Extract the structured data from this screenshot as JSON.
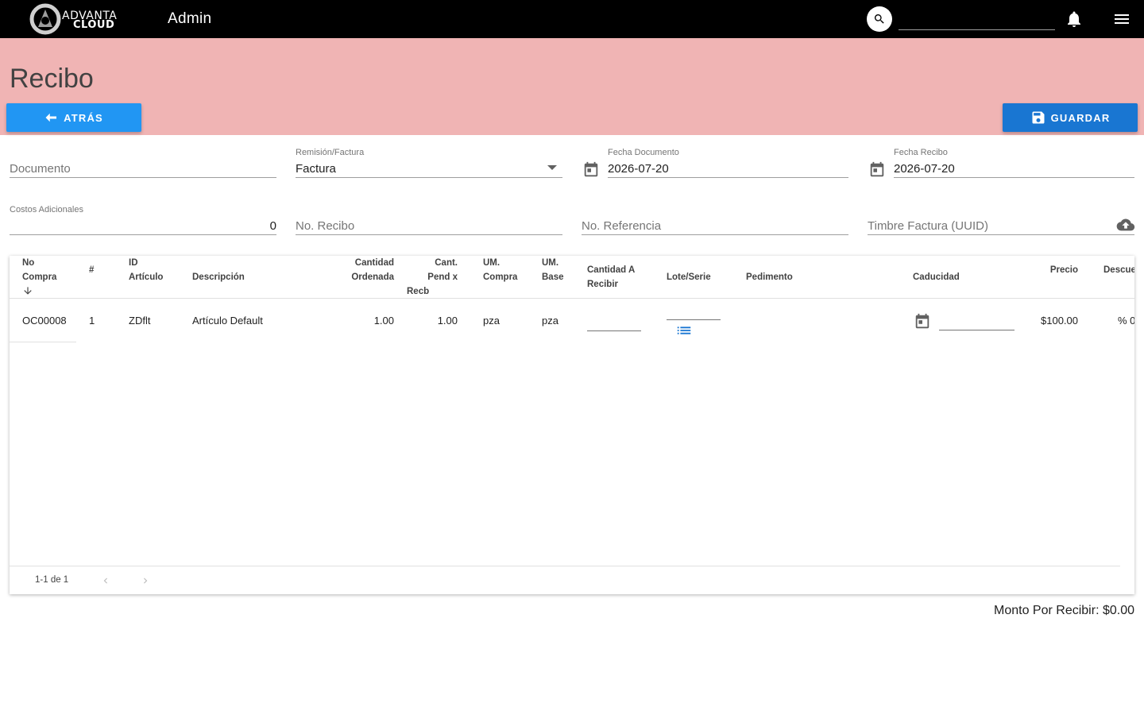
{
  "topbar": {
    "logo_line1": "ADVANTA",
    "logo_line2": "CLOUD",
    "title": "Admin",
    "search_value": "",
    "icons": [
      "search-icon",
      "bell-icon",
      "menu-icon"
    ]
  },
  "header": {
    "title": "Recibo",
    "back_label": "ATRÁS",
    "save_label": "GUARDAR",
    "band_color": "#f0b4b4",
    "back_color": "#2196f3",
    "save_color": "#1976d2"
  },
  "form": {
    "documento": {
      "placeholder": "Documento",
      "value": ""
    },
    "remision_factura": {
      "label": "Remisión/Factura",
      "value": "Factura"
    },
    "fecha_documento": {
      "label": "Fecha Documento",
      "value": "2026-07-20"
    },
    "fecha_recibo": {
      "label": "Fecha Recibo",
      "value": "2026-07-20"
    },
    "costos_adicionales": {
      "label": "Costos Adicionales",
      "value": "0"
    },
    "no_recibo": {
      "placeholder": "No. Recibo",
      "value": ""
    },
    "no_referencia": {
      "placeholder": "No. Referencia",
      "value": ""
    },
    "timbre": {
      "placeholder": "Timbre Factura (UUID)",
      "value": ""
    }
  },
  "table": {
    "headers": {
      "no_compra_1": "No",
      "no_compra_2": "Compra",
      "num": "#",
      "id_articulo_1": "ID",
      "id_articulo_2": "Artículo",
      "descripcion": "Descripción",
      "cant_ordenada_1": "Cantidad",
      "cant_ordenada_2": "Ordenada",
      "cant_pend_1": "Cant.",
      "cant_pend_2": "Pend x",
      "cant_pend_3": "Recb",
      "um_compra_1": "UM.",
      "um_compra_2": "Compra",
      "um_base_1": "UM.",
      "um_base_2": "Base",
      "cant_recibir_1": "Cantidad A",
      "cant_recibir_2": "Recibir",
      "lote_serie": "Lote/Serie",
      "pedimento": "Pedimento",
      "caducidad": "Caducidad",
      "precio": "Precio",
      "descuento": "Descue"
    },
    "rows": [
      {
        "no_compra": "OC00008",
        "num": "1",
        "id_articulo": "ZDflt",
        "descripcion": "Artículo Default",
        "cant_ordenada": "1.00",
        "cant_pend": "1.00",
        "um_compra": "pza",
        "um_base": "pza",
        "precio": "$100.00",
        "descuento": "% 0"
      }
    ],
    "pagination": "1-1 de 1"
  },
  "summary": {
    "monto_label": "Monto Por Recibir: $0.00"
  }
}
